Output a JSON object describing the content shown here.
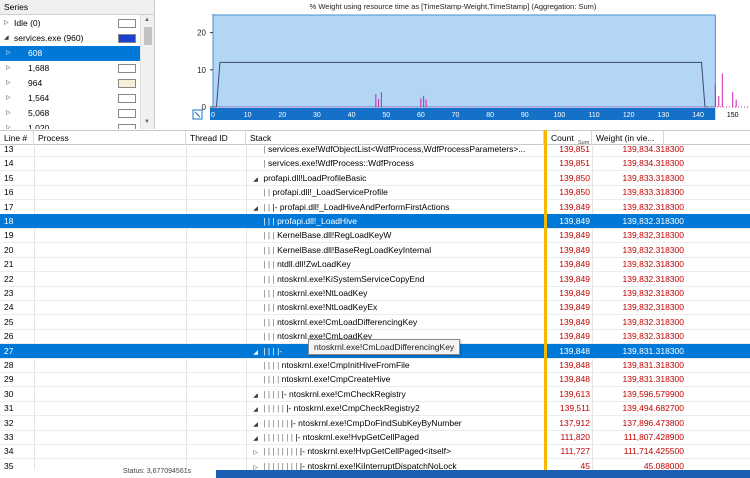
{
  "series_panel": {
    "header": "Series",
    "rows": [
      {
        "label": "Idle (0)",
        "expander": "▷",
        "color": "#ffffff",
        "selected": false,
        "indent": false
      },
      {
        "label": "services.exe (960)",
        "expander": "◢",
        "color": "#1f3fd0",
        "selected": false,
        "indent": false
      },
      {
        "label": "608",
        "expander": "▷",
        "color": "#0078d7",
        "selected": true,
        "indent": true
      },
      {
        "label": "1,688",
        "expander": "▷",
        "color": "#ffffff",
        "selected": false,
        "indent": true
      },
      {
        "label": "964",
        "expander": "▷",
        "color": "#f5f0d6",
        "selected": false,
        "indent": true
      },
      {
        "label": "1,564",
        "expander": "▷",
        "color": "#ffffff",
        "selected": false,
        "indent": true
      },
      {
        "label": "5,068",
        "expander": "▷",
        "color": "#ffffff",
        "selected": false,
        "indent": true
      },
      {
        "label": "1,020",
        "expander": "▷",
        "color": "#ffffff",
        "selected": false,
        "indent": true
      }
    ]
  },
  "chart": {
    "title": "% Weight using resource time as [TimeStamp-Weight,TimeStamp] (Aggregation: Sum)",
    "selection_color": "#b3d6f5",
    "spike_color": "#d020b0"
  },
  "chart_data": {
    "type": "line",
    "yticks": [
      "20",
      "10",
      "0"
    ],
    "ylim": [
      0,
      25
    ],
    "xticks": [
      "0",
      "10",
      "20",
      "30",
      "40",
      "50",
      "60",
      "70",
      "80",
      "90",
      "100",
      "110",
      "120",
      "130",
      "140",
      "150"
    ],
    "xlim": [
      0,
      155
    ],
    "selection_range": [
      0,
      145
    ],
    "series": [
      {
        "name": "608",
        "x": [
          0,
          1,
          2,
          3,
          140,
          141,
          142,
          143
        ],
        "y": [
          0,
          0,
          12,
          12,
          12,
          12,
          0,
          0
        ]
      }
    ]
  },
  "table": {
    "columns": {
      "line": "Line #",
      "process": "Process",
      "thread": "Thread ID",
      "stack": "Stack",
      "count": "Count",
      "count_sub": "Sum",
      "weight": "Weight (in vie..."
    },
    "rows": [
      {
        "line": "13",
        "stack": "services.exe!WdfObjectList<WdfProcess,WdfProcessParameters>...",
        "guides": "| ",
        "tri": "",
        "count": "139,851",
        "weight": "139,834.318300"
      },
      {
        "line": "14",
        "stack": "services.exe!WdfProcess::WdfProcess",
        "guides": "| ",
        "tri": "",
        "count": "139,851",
        "weight": "139,834.318300"
      },
      {
        "line": "15",
        "stack": "profapi.dll!LoadProfileBasic",
        "guides": "",
        "tri": "◢",
        "count": "139,850",
        "weight": "139,833.318300"
      },
      {
        "line": "16",
        "stack": "profapi.dll!_LoadServiceProfile",
        "guides": "| | ",
        "tri": "",
        "count": "139,850",
        "weight": "139,833.318300"
      },
      {
        "line": "17",
        "stack": "|- profapi.dll!_LoadHiveAndPerformFirstActions",
        "guides": "| |",
        "tri": "◢",
        "count": "139,849",
        "weight": "139,832.318300"
      },
      {
        "line": "18",
        "stack": "profapi.dll!_LoadHive",
        "guides": "| | | ",
        "tri": "",
        "count": "139,849",
        "weight": "139,832.318300"
      },
      {
        "line": "19",
        "stack": "KernelBase.dll!RegLoadKeyW",
        "guides": "| | | ",
        "tri": "",
        "count": "139,849",
        "weight": "139,832.318300"
      },
      {
        "line": "20",
        "stack": "KernelBase.dll!BaseRegLoadKeyInternal",
        "guides": "| | | ",
        "tri": "",
        "count": "139,849",
        "weight": "139,832.318300"
      },
      {
        "line": "21",
        "stack": "ntdll.dll!ZwLoadKey",
        "guides": "| | | ",
        "tri": "",
        "count": "139,849",
        "weight": "139,832.318300"
      },
      {
        "line": "22",
        "stack": "ntoskrnl.exe!KiSystemServiceCopyEnd",
        "guides": "| | | ",
        "tri": "",
        "count": "139,849",
        "weight": "139,832.318300"
      },
      {
        "line": "23",
        "stack": "ntoskrnl.exe!NtLoadKey",
        "guides": "| | | ",
        "tri": "",
        "count": "139,849",
        "weight": "139,832.318300"
      },
      {
        "line": "24",
        "stack": "ntoskrnl.exe!NtLoadKeyEx",
        "guides": "| | | ",
        "tri": "",
        "count": "139,849",
        "weight": "139,832.318300"
      },
      {
        "line": "25",
        "stack": "ntoskrnl.exe!CmLoadDifferencingKey",
        "guides": "| | | ",
        "tri": "",
        "count": "139,849",
        "weight": "139,832.318300"
      },
      {
        "line": "26",
        "stack": "ntoskrnl.exe!CmLoadKey",
        "guides": "| | | ",
        "tri": "",
        "count": "139,849",
        "weight": "139,832.318300"
      },
      {
        "line": "27",
        "stack": "|-",
        "guides": "| | |",
        "tri": "◢",
        "count": "139,848",
        "weight": "139,831.318300"
      },
      {
        "line": "28",
        "stack": "ntoskrnl.exe!CmpInitHiveFromFile",
        "guides": "| | | | ",
        "tri": "",
        "count": "139,848",
        "weight": "139,831.318300"
      },
      {
        "line": "29",
        "stack": "ntoskrnl.exe!CmpCreateHive",
        "guides": "| | | | ",
        "tri": "",
        "count": "139,848",
        "weight": "139,831.318300"
      },
      {
        "line": "30",
        "stack": "|- ntoskrnl.exe!CmCheckRegistry",
        "guides": "| | | |",
        "tri": "◢",
        "count": "139,613",
        "weight": "139,596.579900"
      },
      {
        "line": "31",
        "stack": "|- ntoskrnl.exe!CmpCheckRegistry2",
        "guides": "| | | | |",
        "tri": "◢",
        "count": "139,511",
        "weight": "139,494.682700"
      },
      {
        "line": "32",
        "stack": "|- ntoskrnl.exe!CmpDoFindSubKeyByNumber",
        "guides": "| | | | | |",
        "tri": "◢",
        "count": "137,912",
        "weight": "137,896.473800"
      },
      {
        "line": "33",
        "stack": "|- ntoskrnl.exe!HvpGetCellPaged",
        "guides": "| | | | | | |",
        "tri": "◢",
        "count": "111,820",
        "weight": "111,807.428900"
      },
      {
        "line": "34",
        "stack": "|- ntoskrnl.exe!HvpGetCellPaged<itself>",
        "guides": "| | | | | | | |",
        "tri": "▷",
        "count": "111,727",
        "weight": "111,714.425500"
      },
      {
        "line": "35",
        "stack": "|- ntoskrnl.exe!KiInterruptDispatchNoLock",
        "guides": "| | | | | | | |",
        "tri": "▷",
        "count": "45",
        "weight": "45.088000"
      }
    ],
    "selected_line": "18",
    "hover_line": "27"
  },
  "tooltip": "ntoskrnl.exe!CmLoadDifferencingKey",
  "status": "Status: 3,677094561s"
}
